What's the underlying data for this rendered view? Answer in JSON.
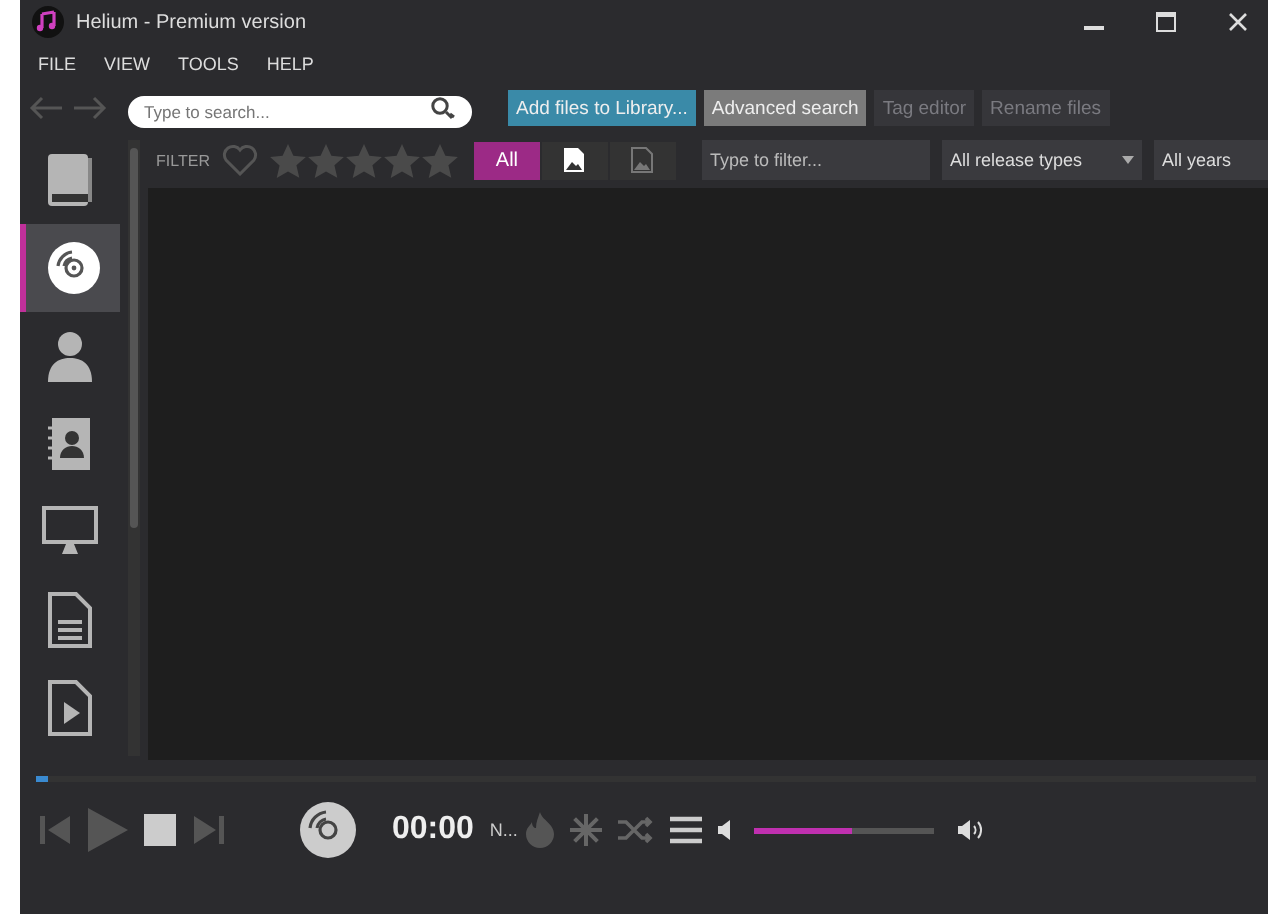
{
  "window": {
    "title": "Helium - Premium version"
  },
  "menu": [
    "FILE",
    "VIEW",
    "TOOLS",
    "HELP"
  ],
  "toolbar": {
    "search": {
      "placeholder": "Type to search..."
    },
    "buttons": [
      {
        "label": "Add files to Library...",
        "kind": "primary",
        "disabled": false
      },
      {
        "label": "Advanced search",
        "kind": "secondary",
        "disabled": false
      },
      {
        "label": "Tag editor",
        "kind": "secondary",
        "disabled": true
      },
      {
        "label": "Rename files",
        "kind": "secondary",
        "disabled": true
      }
    ]
  },
  "sidebar": {
    "items": [
      {
        "kind": "book",
        "selected": false
      },
      {
        "kind": "disc",
        "selected": true
      },
      {
        "kind": "person",
        "selected": false
      },
      {
        "kind": "contacts",
        "selected": false
      },
      {
        "kind": "monitor",
        "selected": false
      },
      {
        "kind": "document",
        "selected": false
      },
      {
        "kind": "video",
        "selected": false
      }
    ]
  },
  "filter_bar": {
    "label": "FILTER",
    "favorite": false,
    "stars": 0,
    "segments": [
      {
        "kind": "text",
        "label": "All",
        "selected": true
      },
      {
        "kind": "image",
        "selected": false
      },
      {
        "kind": "image-dim",
        "selected": false
      }
    ],
    "filter_field": {
      "placeholder": "Type to filter..."
    },
    "release_types": "All release types",
    "years": "All years"
  },
  "player": {
    "progress": {
      "level": 0.01
    },
    "time": "00:00",
    "track": "N...",
    "volume": {
      "level": 0.55
    }
  }
}
